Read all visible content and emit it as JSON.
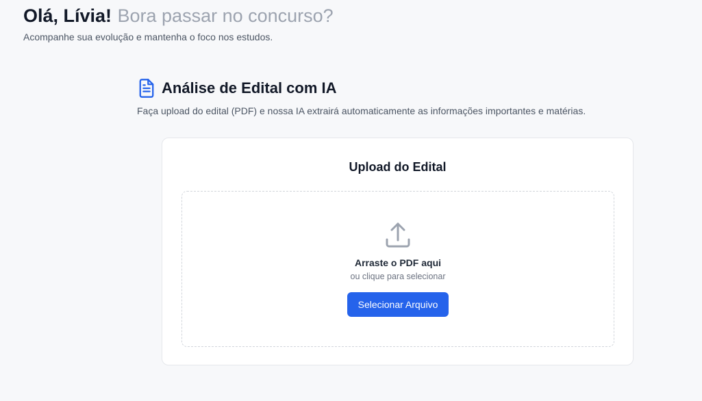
{
  "header": {
    "greeting": "Olá, Lívia!",
    "tagline": "Bora passar no concurso?",
    "subtitle": "Acompanhe sua evolução e mantenha o foco nos estudos."
  },
  "section": {
    "icon": "document-icon",
    "title": "Análise de Edital com IA",
    "description": "Faça upload do edital (PDF) e nossa IA extrairá automaticamente as informações importantes e matérias."
  },
  "upload_card": {
    "title": "Upload do Edital",
    "dropzone": {
      "icon": "upload-icon",
      "title": "Arraste o PDF aqui",
      "subtitle": "ou clique para selecionar",
      "button_label": "Selecionar Arquivo"
    }
  },
  "colors": {
    "accent": "#2563eb",
    "background": "#f7f8fa",
    "muted_text": "#9ca3af"
  }
}
